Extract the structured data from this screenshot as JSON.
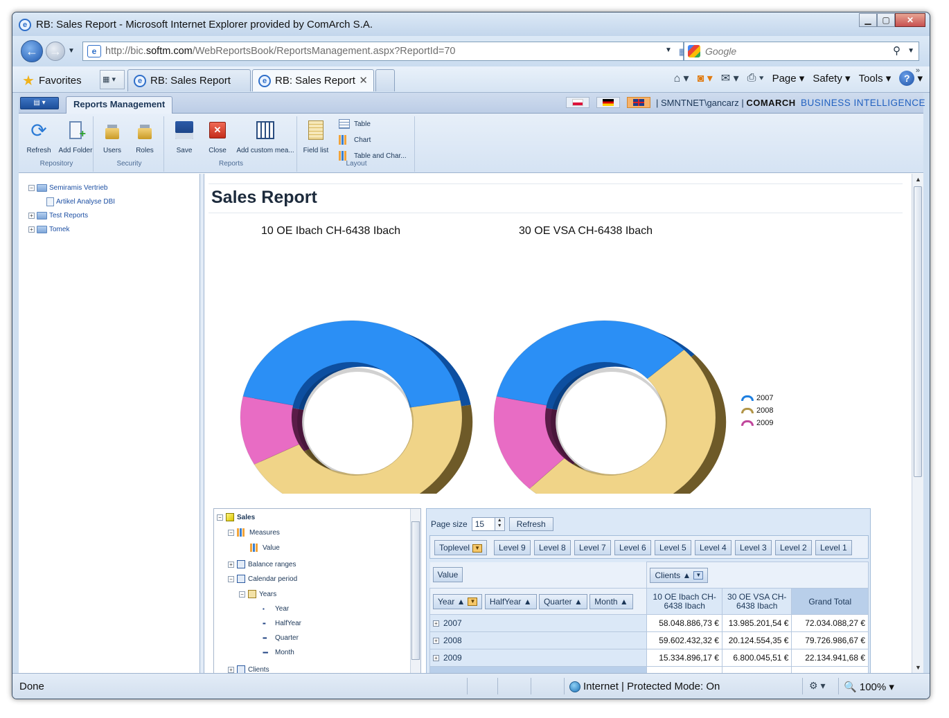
{
  "window": {
    "title": "RB: Sales Report - Microsoft Internet Explorer provided by ComArch S.A."
  },
  "address": {
    "url_prefix": "http://bic.",
    "url_domain": "softm.com",
    "url_path": "/WebReportsBook/ReportsManagement.aspx?ReportId=70",
    "search_placeholder": "Google"
  },
  "favorites_bar": {
    "favorites_label": "Favorites",
    "tabs": [
      {
        "label": "RB: Sales Report",
        "active": false
      },
      {
        "label": "RB: Sales Report",
        "active": true
      }
    ],
    "commands": {
      "page": "Page",
      "safety": "Safety",
      "tools": "Tools"
    }
  },
  "app": {
    "tab_label": "Reports Management",
    "user": "SMNTNET\\gancarz",
    "brand": "COMARCH",
    "product": "BUSINESS INTELLIGENCE",
    "languages": [
      "pl",
      "de",
      "en"
    ],
    "ribbon": {
      "groups": [
        {
          "label": "Repository",
          "buttons": [
            "Refresh",
            "Add Folder"
          ]
        },
        {
          "label": "Security",
          "buttons": [
            "Users",
            "Roles"
          ]
        },
        {
          "label": "Reports",
          "buttons": [
            "Save",
            "Close",
            "Add custom mea..."
          ]
        },
        {
          "label": "Layout",
          "buttons": [
            "Field list"
          ],
          "small_buttons": [
            "Table",
            "Chart",
            "Table and Char..."
          ]
        }
      ]
    }
  },
  "repository_tree": [
    {
      "label": "Semiramis Vertrieb",
      "expanded": true,
      "children": [
        {
          "label": "Artikel Analyse DBI"
        }
      ]
    },
    {
      "label": "Test Reports",
      "expanded": false
    },
    {
      "label": "Tomek",
      "expanded": false
    }
  ],
  "report": {
    "title": "Sales Report"
  },
  "chart_data": {
    "type": "pie",
    "variant": "3d-doughnut",
    "series_names": [
      "2007",
      "2008",
      "2009"
    ],
    "colors": {
      "2007": "#1e7fe0",
      "2008": "#e8c770",
      "2009": "#e060b8"
    },
    "legend_position": "right",
    "charts": [
      {
        "title": "10  OE Ibach  CH-6438 Ibach",
        "values": [
          58048886.73,
          59602432.32,
          15334896.17
        ]
      },
      {
        "title": "30  OE VSA  CH-6438 Ibach",
        "values": [
          13985201.54,
          20124554.35,
          6800045.51
        ]
      }
    ]
  },
  "field_list": {
    "root": "Sales",
    "items": [
      {
        "label": "Measures",
        "level": 1
      },
      {
        "label": "Value",
        "level": 2
      },
      {
        "label": "Balance ranges",
        "level": 1
      },
      {
        "label": "Calendar period",
        "level": 1
      },
      {
        "label": "Years",
        "level": 2
      },
      {
        "label": "Year",
        "level": 3
      },
      {
        "label": "HalfYear",
        "level": 3
      },
      {
        "label": "Quarter",
        "level": 3
      },
      {
        "label": "Month",
        "level": 3
      },
      {
        "label": "Clients",
        "level": 1
      }
    ]
  },
  "pivot": {
    "page_size_label": "Page size",
    "page_size": "15",
    "refresh_label": "Refresh",
    "levels": [
      "Toplevel",
      "Level 9",
      "Level 8",
      "Level 7",
      "Level 6",
      "Level 5",
      "Level 4",
      "Level 3",
      "Level 2",
      "Level 1"
    ],
    "data_field": "Value",
    "column_field": "Clients",
    "row_fields": [
      "Year",
      "HalfYear",
      "Quarter",
      "Month"
    ],
    "columns": [
      "10 OE Ibach CH-6438 Ibach",
      "30 OE VSA CH-6438 Ibach",
      "Grand Total"
    ],
    "rows": [
      {
        "label": "2007",
        "values": [
          "58.048.886,73 €",
          "13.985.201,54 €",
          "72.034.088,27 €"
        ]
      },
      {
        "label": "2008",
        "values": [
          "59.602.432,32 €",
          "20.124.554,35 €",
          "79.726.986,67 €"
        ]
      },
      {
        "label": "2009",
        "values": [
          "15.334.896,17 €",
          "6.800.045,51 €",
          "22.134.941,68 €"
        ]
      }
    ]
  },
  "status": {
    "left": "Done",
    "zone": "Internet | Protected Mode: On",
    "zoom": "100%"
  }
}
